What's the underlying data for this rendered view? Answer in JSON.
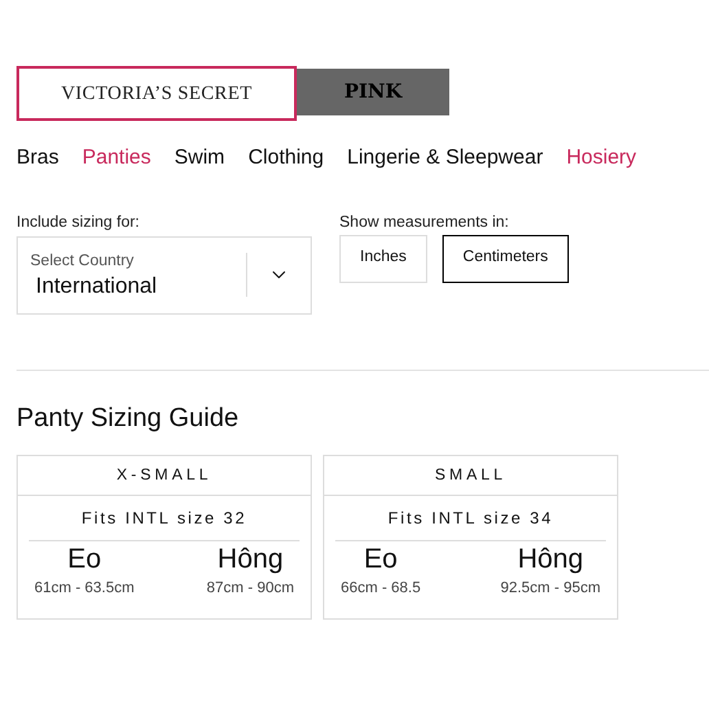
{
  "brand_tabs": [
    {
      "label": "VICTORIA’S SECRET",
      "kind": "serif",
      "selected": true
    },
    {
      "label": "PINK",
      "kind": "block",
      "selected": false
    }
  ],
  "nav": [
    {
      "label": "Bras",
      "color": "#111111"
    },
    {
      "label": "Panties",
      "color": "#c8295c"
    },
    {
      "label": "Swim",
      "color": "#111111"
    },
    {
      "label": "Clothing",
      "color": "#111111"
    },
    {
      "label": "Lingerie & Sleepwear",
      "color": "#111111"
    },
    {
      "label": "Hosiery",
      "color": "#c8295c"
    }
  ],
  "sizing": {
    "label": "Include sizing for:",
    "select_label": "Select Country",
    "value": "International"
  },
  "units": {
    "label": "Show measurements in:",
    "options": [
      {
        "label": "Inches",
        "selected": false
      },
      {
        "label": "Centimeters",
        "selected": true
      }
    ]
  },
  "title": "Panty Sizing Guide",
  "cards": [
    {
      "size": "X-SMALL",
      "fits": "Fits INTL size 32",
      "measures": [
        {
          "name": "Eo",
          "range": "61cm - 63.5cm"
        },
        {
          "name": "Hông",
          "range": "87cm - 90cm"
        }
      ]
    },
    {
      "size": "SMALL",
      "fits": "Fits INTL size 34",
      "measures": [
        {
          "name": "Eo",
          "range": "66cm - 68.5"
        },
        {
          "name": "Hông",
          "range": "92.5cm - 95cm"
        }
      ]
    }
  ]
}
